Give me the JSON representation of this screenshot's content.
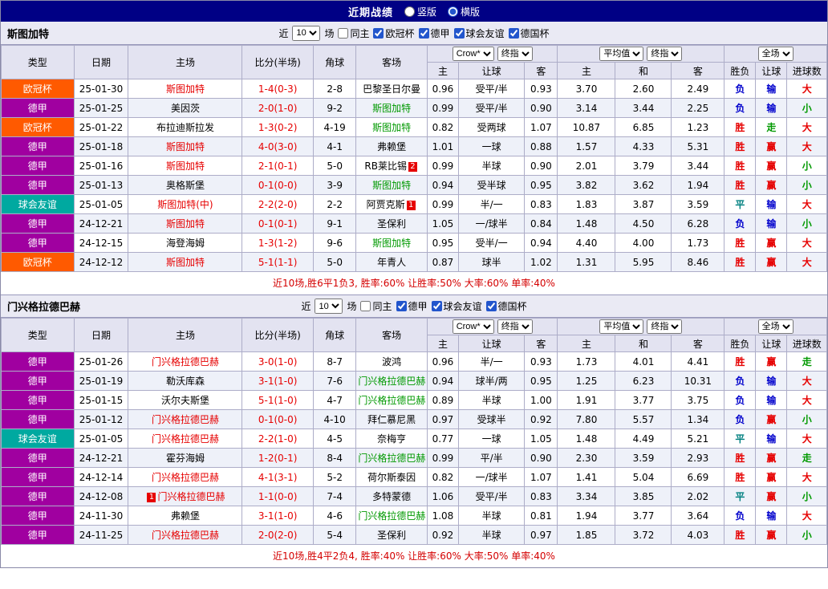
{
  "topbar": {
    "title": "近期战绩",
    "options": [
      {
        "label": "竖版",
        "selected": false
      },
      {
        "label": "横版",
        "selected": true
      }
    ]
  },
  "filter": {
    "prefix": "近",
    "suffix": "场",
    "same_home_label": "同主"
  },
  "table_header": {
    "static_cols": [
      "类型",
      "日期",
      "主场",
      "比分(半场)",
      "角球",
      "客场"
    ],
    "group1": {
      "selects": [
        "Crow*",
        "终指"
      ],
      "cols": [
        "主",
        "让球",
        "客"
      ]
    },
    "group2": {
      "selects": [
        "平均值",
        "终指"
      ],
      "cols": [
        "主",
        "和",
        "客"
      ]
    },
    "group3": {
      "selects": [
        "全场"
      ],
      "cols": [
        "胜负",
        "让球",
        "进球数"
      ]
    }
  },
  "type_colors": {
    "欧冠杯": "#FF5A00",
    "德甲": "#A000A0",
    "球会友谊": "#00A9A0"
  },
  "team_colors": {
    "red": "#E60000",
    "green": "#009900",
    "black": "#000000"
  },
  "result_colors": {
    "胜": "#E60000",
    "平": "#008080",
    "负": "#0000CC",
    "赢": "#E60000",
    "走": "#009900",
    "输": "#0000CC",
    "大": "#E60000",
    "小": "#009900"
  },
  "sections": [
    {
      "team": "斯图加特",
      "filters": {
        "count": "10",
        "same_home": false,
        "leagues": [
          {
            "label": "欧冠杯",
            "checked": true
          },
          {
            "label": "德甲",
            "checked": true
          },
          {
            "label": "球会友谊",
            "checked": true
          },
          {
            "label": "德国杯",
            "checked": true
          }
        ]
      },
      "rows": [
        {
          "type": "欧冠杯",
          "date": "25-01-30",
          "home": {
            "text": "斯图加特",
            "color": "red"
          },
          "score": "1-4(0-3)",
          "corner": "2-8",
          "away": {
            "text": "巴黎圣日尔曼",
            "color": "black"
          },
          "odds": [
            "0.96",
            "受平/半",
            "0.93"
          ],
          "avg": [
            "3.70",
            "2.60",
            "2.49"
          ],
          "results": [
            "负",
            "输",
            "大"
          ]
        },
        {
          "type": "德甲",
          "date": "25-01-25",
          "home": {
            "text": "美因茨",
            "color": "black"
          },
          "score": "2-0(1-0)",
          "corner": "9-2",
          "away": {
            "text": "斯图加特",
            "color": "green"
          },
          "odds": [
            "0.99",
            "受平/半",
            "0.90"
          ],
          "avg": [
            "3.14",
            "3.44",
            "2.25"
          ],
          "results": [
            "负",
            "输",
            "小"
          ]
        },
        {
          "type": "欧冠杯",
          "date": "25-01-22",
          "home": {
            "text": "布拉迪斯拉发",
            "color": "black"
          },
          "score": "1-3(0-2)",
          "corner": "4-19",
          "away": {
            "text": "斯图加特",
            "color": "green"
          },
          "odds": [
            "0.82",
            "受两球",
            "1.07"
          ],
          "avg": [
            "10.87",
            "6.85",
            "1.23"
          ],
          "results": [
            "胜",
            "走",
            "大"
          ]
        },
        {
          "type": "德甲",
          "date": "25-01-18",
          "home": {
            "text": "斯图加特",
            "color": "red"
          },
          "score": "4-0(3-0)",
          "corner": "4-1",
          "away": {
            "text": "弗赖堡",
            "color": "black"
          },
          "odds": [
            "1.01",
            "一球",
            "0.88"
          ],
          "avg": [
            "1.57",
            "4.33",
            "5.31"
          ],
          "results": [
            "胜",
            "赢",
            "大"
          ]
        },
        {
          "type": "德甲",
          "date": "25-01-16",
          "home": {
            "text": "斯图加特",
            "color": "red"
          },
          "score": "2-1(0-1)",
          "corner": "5-0",
          "away": {
            "text": "RB莱比锡",
            "color": "black",
            "badge": "2",
            "badge_pos": "after"
          },
          "odds": [
            "0.99",
            "半球",
            "0.90"
          ],
          "avg": [
            "2.01",
            "3.79",
            "3.44"
          ],
          "results": [
            "胜",
            "赢",
            "小"
          ]
        },
        {
          "type": "德甲",
          "date": "25-01-13",
          "home": {
            "text": "奥格斯堡",
            "color": "black"
          },
          "score": "0-1(0-0)",
          "corner": "3-9",
          "away": {
            "text": "斯图加特",
            "color": "green"
          },
          "odds": [
            "0.94",
            "受半球",
            "0.95"
          ],
          "avg": [
            "3.82",
            "3.62",
            "1.94"
          ],
          "results": [
            "胜",
            "赢",
            "小"
          ]
        },
        {
          "type": "球会友谊",
          "date": "25-01-05",
          "home": {
            "text": "斯图加特(中)",
            "color": "red"
          },
          "score": "2-2(2-0)",
          "corner": "2-2",
          "away": {
            "text": "阿贾克斯",
            "color": "black",
            "badge": "1",
            "badge_pos": "after"
          },
          "odds": [
            "0.99",
            "半/一",
            "0.83"
          ],
          "avg": [
            "1.83",
            "3.87",
            "3.59"
          ],
          "results": [
            "平",
            "输",
            "大"
          ]
        },
        {
          "type": "德甲",
          "date": "24-12-21",
          "home": {
            "text": "斯图加特",
            "color": "red"
          },
          "score": "0-1(0-1)",
          "corner": "9-1",
          "away": {
            "text": "圣保利",
            "color": "black"
          },
          "odds": [
            "1.05",
            "一/球半",
            "0.84"
          ],
          "avg": [
            "1.48",
            "4.50",
            "6.28"
          ],
          "results": [
            "负",
            "输",
            "小"
          ]
        },
        {
          "type": "德甲",
          "date": "24-12-15",
          "home": {
            "text": "海登海姆",
            "color": "black"
          },
          "score": "1-3(1-2)",
          "corner": "9-6",
          "away": {
            "text": "斯图加特",
            "color": "green"
          },
          "odds": [
            "0.95",
            "受半/一",
            "0.94"
          ],
          "avg": [
            "4.40",
            "4.00",
            "1.73"
          ],
          "results": [
            "胜",
            "赢",
            "大"
          ]
        },
        {
          "type": "欧冠杯",
          "date": "24-12-12",
          "home": {
            "text": "斯图加特",
            "color": "red"
          },
          "score": "5-1(1-1)",
          "corner": "5-0",
          "away": {
            "text": "年青人",
            "color": "black"
          },
          "odds": [
            "0.87",
            "球半",
            "1.02"
          ],
          "avg": [
            "1.31",
            "5.95",
            "8.46"
          ],
          "results": [
            "胜",
            "赢",
            "大"
          ]
        }
      ],
      "summary": "近10场,胜6平1负3, 胜率:60% 让胜率:50% 大率:60% 单率:40%"
    },
    {
      "team": "门兴格拉德巴赫",
      "filters": {
        "count": "10",
        "same_home": false,
        "leagues": [
          {
            "label": "德甲",
            "checked": true
          },
          {
            "label": "球会友谊",
            "checked": true
          },
          {
            "label": "德国杯",
            "checked": true
          }
        ]
      },
      "rows": [
        {
          "type": "德甲",
          "date": "25-01-26",
          "home": {
            "text": "门兴格拉德巴赫",
            "color": "red"
          },
          "score": "3-0(1-0)",
          "corner": "8-7",
          "away": {
            "text": "波鸿",
            "color": "black"
          },
          "odds": [
            "0.96",
            "半/一",
            "0.93"
          ],
          "avg": [
            "1.73",
            "4.01",
            "4.41"
          ],
          "results": [
            "胜",
            "赢",
            "走"
          ]
        },
        {
          "type": "德甲",
          "date": "25-01-19",
          "home": {
            "text": "勒沃库森",
            "color": "black"
          },
          "score": "3-1(1-0)",
          "corner": "7-6",
          "away": {
            "text": "门兴格拉德巴赫",
            "color": "green"
          },
          "odds": [
            "0.94",
            "球半/两",
            "0.95"
          ],
          "avg": [
            "1.25",
            "6.23",
            "10.31"
          ],
          "results": [
            "负",
            "输",
            "大"
          ]
        },
        {
          "type": "德甲",
          "date": "25-01-15",
          "home": {
            "text": "沃尔夫斯堡",
            "color": "black"
          },
          "score": "5-1(1-0)",
          "corner": "4-7",
          "away": {
            "text": "门兴格拉德巴赫",
            "color": "green"
          },
          "odds": [
            "0.89",
            "半球",
            "1.00"
          ],
          "avg": [
            "1.91",
            "3.77",
            "3.75"
          ],
          "results": [
            "负",
            "输",
            "大"
          ]
        },
        {
          "type": "德甲",
          "date": "25-01-12",
          "home": {
            "text": "门兴格拉德巴赫",
            "color": "red"
          },
          "score": "0-1(0-0)",
          "corner": "4-10",
          "away": {
            "text": "拜仁慕尼黑",
            "color": "black"
          },
          "odds": [
            "0.97",
            "受球半",
            "0.92"
          ],
          "avg": [
            "7.80",
            "5.57",
            "1.34"
          ],
          "results": [
            "负",
            "赢",
            "小"
          ]
        },
        {
          "type": "球会友谊",
          "date": "25-01-05",
          "home": {
            "text": "门兴格拉德巴赫",
            "color": "red"
          },
          "score": "2-2(1-0)",
          "corner": "4-5",
          "away": {
            "text": "奈梅亨",
            "color": "black"
          },
          "odds": [
            "0.77",
            "一球",
            "1.05"
          ],
          "avg": [
            "1.48",
            "4.49",
            "5.21"
          ],
          "results": [
            "平",
            "输",
            "大"
          ]
        },
        {
          "type": "德甲",
          "date": "24-12-21",
          "home": {
            "text": "霍芬海姆",
            "color": "black"
          },
          "score": "1-2(0-1)",
          "corner": "8-4",
          "away": {
            "text": "门兴格拉德巴赫",
            "color": "green"
          },
          "odds": [
            "0.99",
            "平/半",
            "0.90"
          ],
          "avg": [
            "2.30",
            "3.59",
            "2.93"
          ],
          "results": [
            "胜",
            "赢",
            "走"
          ]
        },
        {
          "type": "德甲",
          "date": "24-12-14",
          "home": {
            "text": "门兴格拉德巴赫",
            "color": "red"
          },
          "score": "4-1(3-1)",
          "corner": "5-2",
          "away": {
            "text": "荷尔斯泰因",
            "color": "black"
          },
          "odds": [
            "0.82",
            "一/球半",
            "1.07"
          ],
          "avg": [
            "1.41",
            "5.04",
            "6.69"
          ],
          "results": [
            "胜",
            "赢",
            "大"
          ]
        },
        {
          "type": "德甲",
          "date": "24-12-08",
          "home": {
            "text": "门兴格拉德巴赫",
            "color": "red",
            "badge": "1",
            "badge_pos": "before"
          },
          "score": "1-1(0-0)",
          "corner": "7-4",
          "away": {
            "text": "多特蒙德",
            "color": "black"
          },
          "odds": [
            "1.06",
            "受平/半",
            "0.83"
          ],
          "avg": [
            "3.34",
            "3.85",
            "2.02"
          ],
          "results": [
            "平",
            "赢",
            "小"
          ]
        },
        {
          "type": "德甲",
          "date": "24-11-30",
          "home": {
            "text": "弗赖堡",
            "color": "black"
          },
          "score": "3-1(1-0)",
          "corner": "4-6",
          "away": {
            "text": "门兴格拉德巴赫",
            "color": "green"
          },
          "odds": [
            "1.08",
            "半球",
            "0.81"
          ],
          "avg": [
            "1.94",
            "3.77",
            "3.64"
          ],
          "results": [
            "负",
            "输",
            "大"
          ]
        },
        {
          "type": "德甲",
          "date": "24-11-25",
          "home": {
            "text": "门兴格拉德巴赫",
            "color": "red"
          },
          "score": "2-0(2-0)",
          "corner": "5-4",
          "away": {
            "text": "圣保利",
            "color": "black"
          },
          "odds": [
            "0.92",
            "半球",
            "0.97"
          ],
          "avg": [
            "1.85",
            "3.72",
            "4.03"
          ],
          "results": [
            "胜",
            "赢",
            "小"
          ]
        }
      ],
      "summary": "近10场,胜4平2负4, 胜率:40% 让胜率:60% 大率:50% 单率:40%"
    }
  ]
}
